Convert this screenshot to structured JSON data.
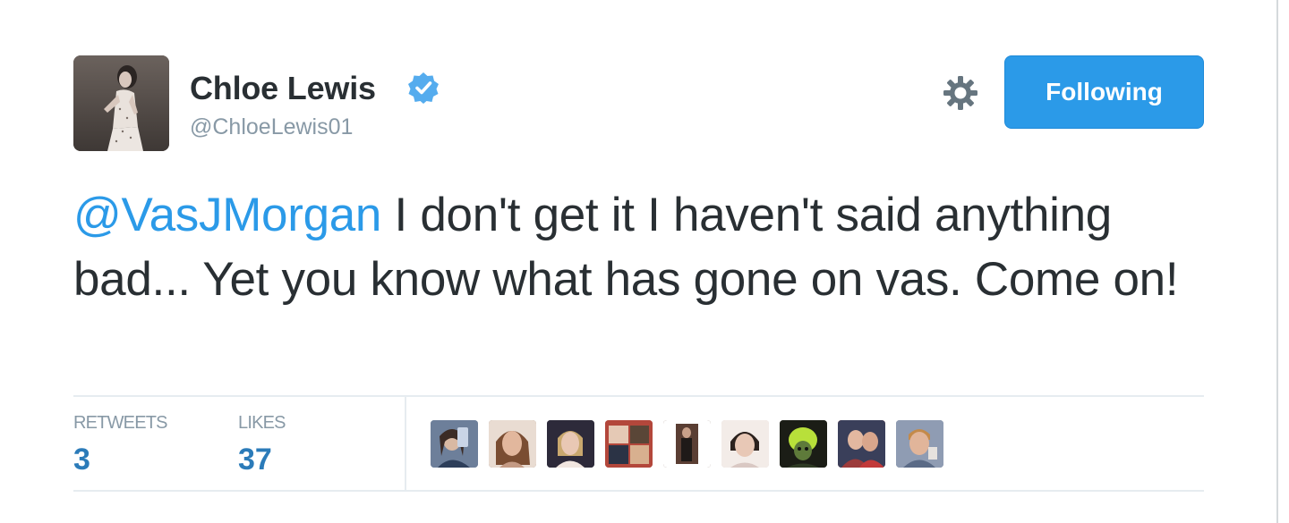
{
  "tweet": {
    "author": {
      "display_name": "Chloe Lewis",
      "handle": "@ChloeLewis01",
      "verified": true,
      "avatar_icon": "profile-photo"
    },
    "actions": {
      "settings_icon": "gear-icon",
      "follow_label": "Following"
    },
    "text": {
      "mention": "@VasJMorgan",
      "body": " I don't get it I haven't said anything bad... Yet you know what has gone on vas. Come on!"
    },
    "stats": {
      "retweets_label": "RETWEETS",
      "retweets_value": "3",
      "likes_label": "LIKES",
      "likes_value": "37"
    },
    "likers": [
      {
        "avatar_icon": "profile-photo",
        "color": "#6d7f9a"
      },
      {
        "avatar_icon": "profile-photo",
        "color": "#8a6a55"
      },
      {
        "avatar_icon": "profile-photo",
        "color": "#2d2a3a"
      },
      {
        "avatar_icon": "profile-photo",
        "color": "#b3473b"
      },
      {
        "avatar_icon": "profile-photo",
        "color": "#5a3e33"
      },
      {
        "avatar_icon": "profile-photo",
        "color": "#d9c8c3"
      },
      {
        "avatar_icon": "profile-photo",
        "color": "#2e3a24"
      },
      {
        "avatar_icon": "profile-photo",
        "color": "#9c3b3b"
      },
      {
        "avatar_icon": "profile-photo",
        "color": "#5a6a86"
      }
    ]
  },
  "colors": {
    "accent": "#2b9ae8",
    "link": "#2b9ae8",
    "stat_value": "#2b7bb9",
    "muted": "#8899a6",
    "text": "#292f33",
    "divider": "#e6ecf0"
  }
}
